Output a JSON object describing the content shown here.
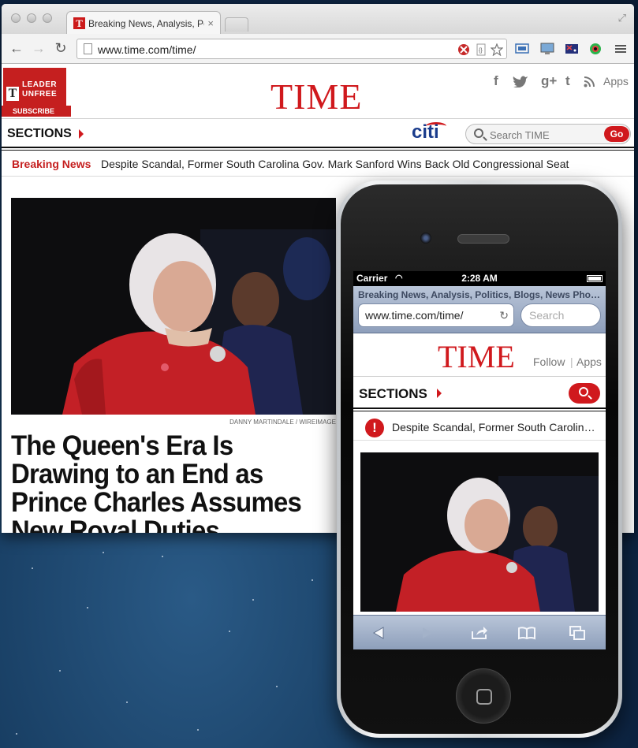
{
  "browser": {
    "tab": {
      "title": "Breaking News, Analysis, Politics, Blogs, News Photos, Video",
      "favicon": "T",
      "close": "×"
    },
    "url": "www.time.com/time/",
    "nav": {
      "back": "←",
      "forward": "→",
      "reload": "↻"
    },
    "extensions": [
      "blocked-icon",
      "code-icon",
      "star-icon",
      "screen-capture-icon",
      "screen-icon",
      "flag-icon",
      "color-picker-icon",
      "menu-icon"
    ]
  },
  "site": {
    "logo": "TIME",
    "badge": {
      "line1": "LEADER",
      "line2": "UNFREE",
      "subscribe": "SUBSCRIBE",
      "masthead": "TIME"
    },
    "social": {
      "facebook": "f",
      "twitter": "t",
      "googleplus": "g+",
      "tumblr": "t",
      "rss": "rss",
      "apps": "Apps"
    },
    "sections": "SECTIONS",
    "sponsor": "citi",
    "search": {
      "placeholder": "Search TIME",
      "go": "Go"
    },
    "breaking": {
      "label": "Breaking News",
      "text": "Despite Scandal, Former South Carolina Gov. Mark Sanford Wins Back Old Congressional Seat"
    },
    "photo_credit": "DANNY MARTINDALE / WIREIMAGE",
    "headline": "The Queen's Era Is Drawing to an End as Prince Charles Assumes New Royal Duties"
  },
  "phone": {
    "status": {
      "carrier": "Carrier",
      "time": "2:28 AM"
    },
    "safari": {
      "title": "Breaking News, Analysis, Politics, Blogs, News Photos, Video",
      "url": "www.time.com/time/",
      "search_placeholder": "Search"
    },
    "site": {
      "logo": "TIME",
      "follow": "Follow",
      "separator": "|",
      "apps": "Apps",
      "sections": "SECTIONS",
      "alert": "!",
      "breaking": "Despite Scandal, Former South Carolina Gov. Mark Sanford Wins Back Old Congressional Seat"
    }
  },
  "colors": {
    "time_red": "#d0191d",
    "citi_blue": "#1a3c8c",
    "safari_chrome": "#9fb0c9"
  }
}
